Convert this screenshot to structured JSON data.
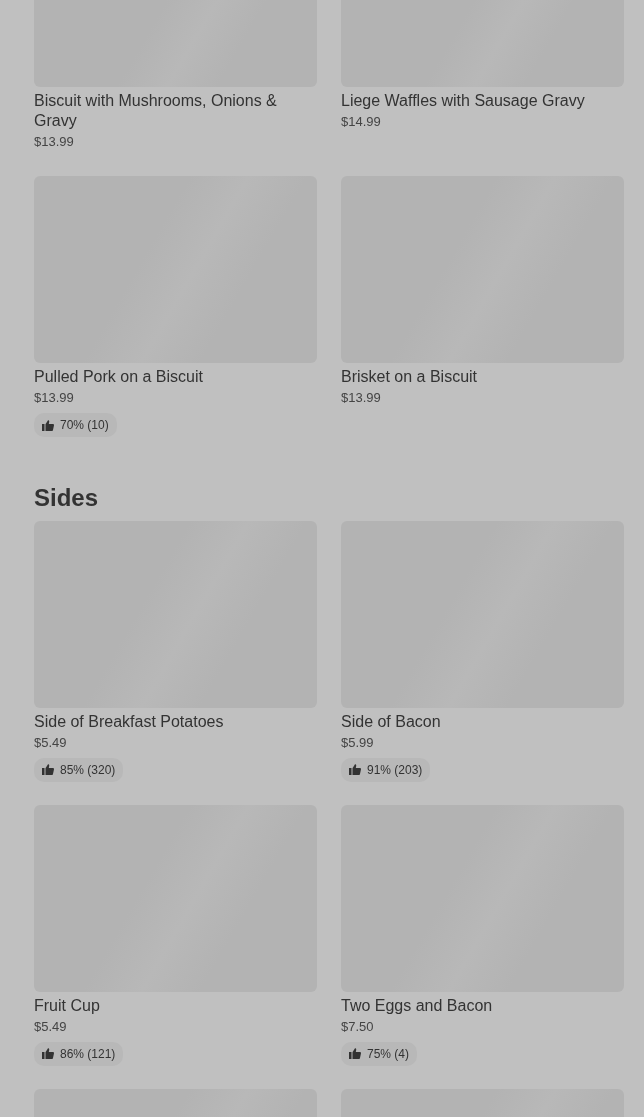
{
  "sections": [
    {
      "items": [
        {
          "kind": "dish",
          "name": "Biscuit with Mushrooms, Onions & Gravy",
          "price": "$13.99"
        },
        {
          "kind": "dish",
          "name": "Liege Waffles with Sausage Gravy",
          "price": "$14.99"
        },
        {
          "kind": "dish",
          "name": "Pulled Pork on a Biscuit",
          "price": "$13.99",
          "rating": "70% (10)"
        },
        {
          "kind": "dish",
          "name": "Brisket on a Biscuit",
          "price": "$13.99"
        }
      ]
    },
    {
      "title": "Sides",
      "items": [
        {
          "kind": "dish",
          "name": "Side of Breakfast Potatoes",
          "price": "$5.49",
          "rating": "85% (320)"
        },
        {
          "kind": "dish",
          "name": "Side of Bacon",
          "price": "$5.99",
          "rating": "91% (203)"
        },
        {
          "kind": "dish",
          "name": "Fruit Cup",
          "price": "$5.49",
          "rating": "86% (121)"
        },
        {
          "kind": "dish",
          "name": "Two Eggs and Bacon",
          "price": "$7.50",
          "rating": "75% (4)"
        },
        {
          "kind": "loading"
        },
        {
          "kind": "loading"
        }
      ]
    }
  ]
}
